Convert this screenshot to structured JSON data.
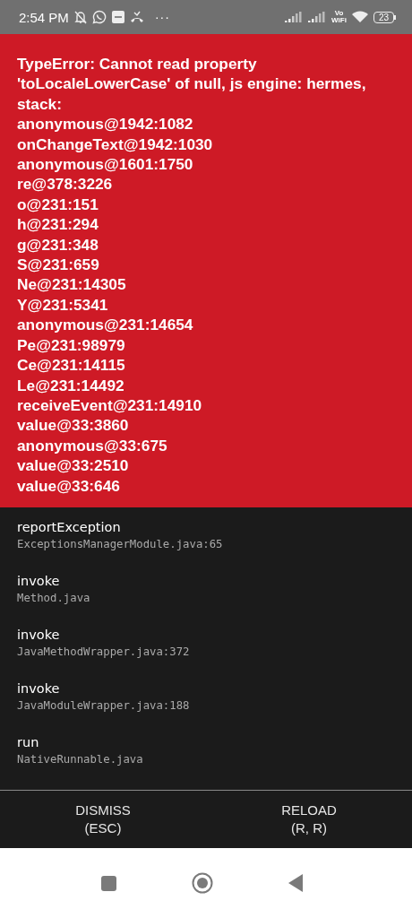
{
  "status_bar": {
    "time": "2:54 PM",
    "more": "···",
    "vowifi": "Vo\nWiFi",
    "battery": "23"
  },
  "error": {
    "message": "TypeError: Cannot read property 'toLocaleLowerCase' of null, js engine: hermes, stack:",
    "stack": [
      "anonymous@1942:1082",
      "onChangeText@1942:1030",
      "anonymous@1601:1750",
      "re@378:3226",
      "o@231:151",
      "h@231:294",
      "g@231:348",
      "S@231:659",
      "Ne@231:14305",
      "Y@231:5341",
      "anonymous@231:14654",
      "Pe@231:98979",
      "Ce@231:14115",
      "Le@231:14492",
      "receiveEvent@231:14910",
      "value@33:3860",
      "anonymous@33:675",
      "value@33:2510",
      "value@33:646"
    ]
  },
  "frames": [
    {
      "method": "reportException",
      "file": "ExceptionsManagerModule.java:65"
    },
    {
      "method": "invoke",
      "file": "Method.java"
    },
    {
      "method": "invoke",
      "file": "JavaMethodWrapper.java:372"
    },
    {
      "method": "invoke",
      "file": "JavaModuleWrapper.java:188"
    },
    {
      "method": "run",
      "file": "NativeRunnable.java"
    }
  ],
  "buttons": [
    {
      "label": "DISMISS",
      "shortcut": "(ESC)"
    },
    {
      "label": "RELOAD",
      "shortcut": "(R, R)"
    }
  ]
}
